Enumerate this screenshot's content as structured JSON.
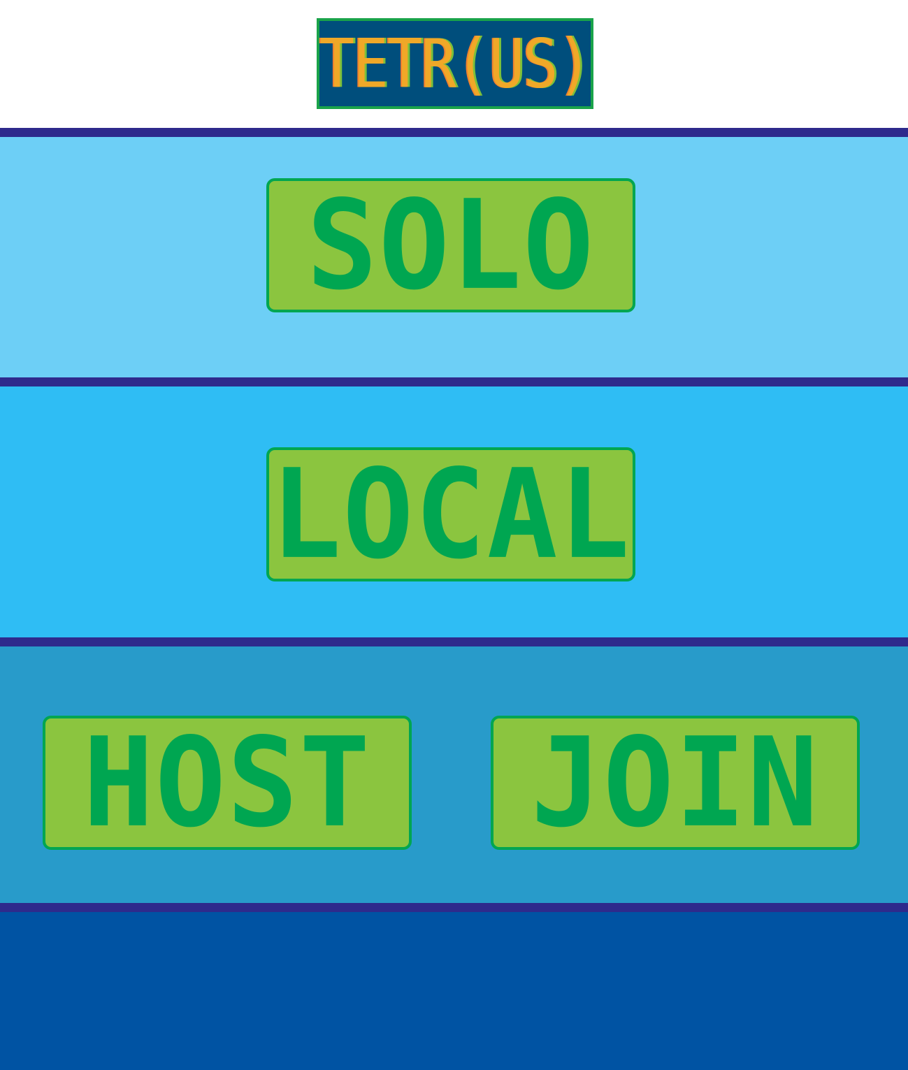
{
  "game": {
    "logo_text": "TETR(US)"
  },
  "menu": {
    "solo_label": "SOLO",
    "local_label": "LOCAL",
    "host_label": "HOST",
    "join_label": "JOIN"
  },
  "colors": {
    "divider": "#2e2a8c",
    "band_solo": "#6dcff6",
    "band_local": "#2fbdf4",
    "band_online": "#289bca",
    "band_bottom": "#0053a3",
    "button_fill": "#8bc53f",
    "button_text": "#00a651",
    "logo_background": "#004e7c",
    "logo_text": "#f0a828"
  }
}
